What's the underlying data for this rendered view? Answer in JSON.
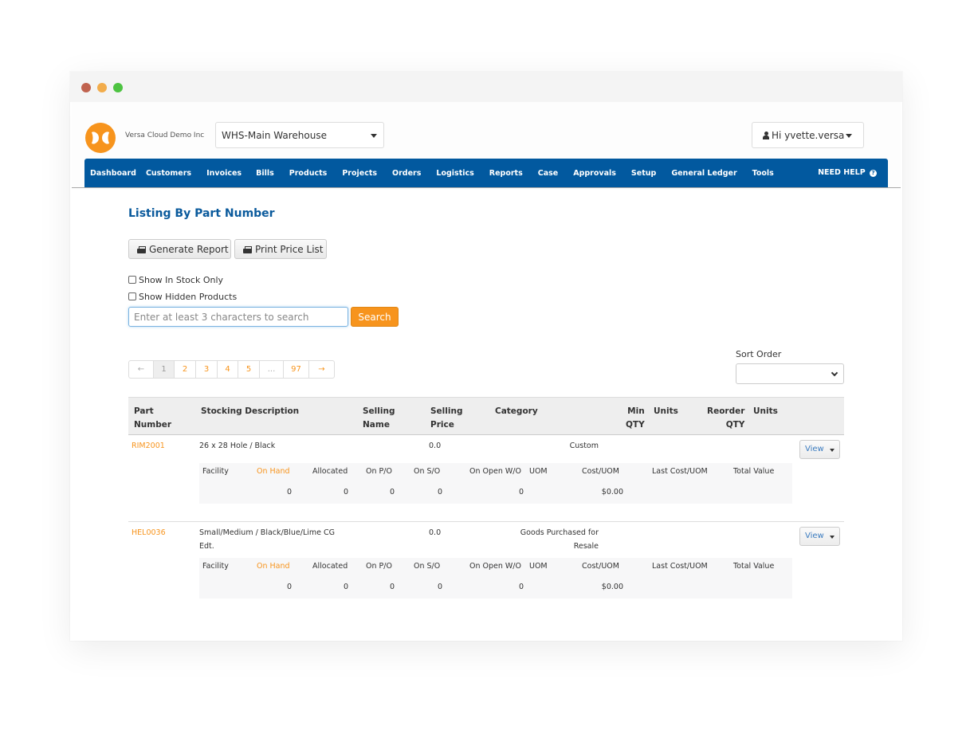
{
  "window": {
    "controls": [
      "close",
      "minimize",
      "maximize"
    ]
  },
  "header": {
    "logo_icon": "versa-logo-icon",
    "company_name": "Versa Cloud Demo Inc",
    "warehouse": "WHS-Main Warehouse",
    "user_greeting": "Hi yvette.versa"
  },
  "nav": {
    "items": [
      "Dashboard",
      "Customers",
      "Invoices",
      "Bills",
      "Products",
      "Projects",
      "Orders",
      "Logistics",
      "Reports",
      "Case",
      "Approvals",
      "Setup",
      "General Ledger",
      "Tools"
    ],
    "help_label": "NEED HELP",
    "help_icon": "?"
  },
  "page": {
    "title": "Listing By Part Number",
    "generate_report_label": "Generate Report",
    "print_price_list_label": "Print Price List",
    "show_in_stock_label": "Show In Stock Only",
    "show_hidden_label": "Show Hidden Products",
    "search_placeholder": "Enter at least 3 characters to search",
    "search_button_label": "Search",
    "sort_order_label": "Sort Order",
    "sort_order_value": ""
  },
  "pagination": {
    "prev": "←",
    "pages": [
      "1",
      "2",
      "3",
      "4",
      "5",
      "...",
      "97"
    ],
    "next": "→",
    "active": "1"
  },
  "table": {
    "headers": {
      "part_number": [
        "Part",
        "Number"
      ],
      "stocking_description": "Stocking Description",
      "selling_name": [
        "Selling",
        "Name"
      ],
      "selling_price": [
        "Selling",
        "Price"
      ],
      "category": "Category",
      "min_qty": [
        "Min",
        "QTY"
      ],
      "units1": "Units",
      "reorder_qty": [
        "Reorder",
        "QTY"
      ],
      "units2": "Units"
    },
    "stock_headers": {
      "facility": "Facility",
      "on_hand": "On Hand",
      "allocated": "Allocated",
      "on_po": "On P/O",
      "on_so": "On S/O",
      "on_open_wo": "On Open W/O",
      "uom": "UOM",
      "cost_uom": "Cost/UOM",
      "last_cost_uom": "Last Cost/UOM",
      "total_value": "Total Value"
    },
    "view_label": "View",
    "rows": [
      {
        "part_number": "RIM2001",
        "description": [
          "26 x 28 Hole / Black",
          ""
        ],
        "selling_name": "",
        "selling_price": "0.0",
        "category": [
          "Custom",
          ""
        ],
        "stock": {
          "facility": "",
          "on_hand": "0",
          "allocated": "0",
          "on_po": "0",
          "on_so": "0",
          "on_open_wo": "0",
          "uom": "",
          "cost_uom": "$0.00",
          "last_cost_uom": "",
          "total_value": ""
        }
      },
      {
        "part_number": "HEL0036",
        "description": [
          "Small/Medium / Black/Blue/Lime CG",
          "Edt."
        ],
        "selling_name": "",
        "selling_price": "0.0",
        "category": [
          "Goods Purchased for",
          "Resale"
        ],
        "stock": {
          "facility": "",
          "on_hand": "0",
          "allocated": "0",
          "on_po": "0",
          "on_so": "0",
          "on_open_wo": "0",
          "uom": "",
          "cost_uom": "$0.00",
          "last_cost_uom": "",
          "total_value": ""
        }
      }
    ]
  }
}
